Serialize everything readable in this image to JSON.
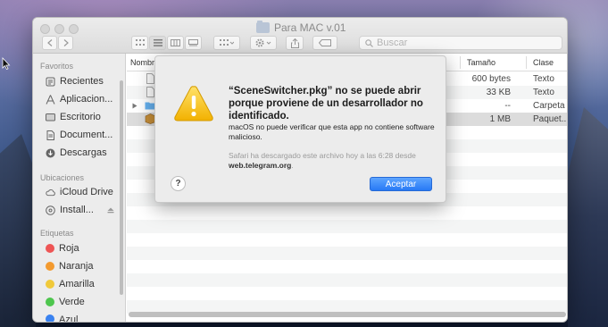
{
  "window": {
    "title": "Para MAC v.01",
    "search_placeholder": "Buscar"
  },
  "sidebar": {
    "favorites_heading": "Favoritos",
    "favorites": [
      {
        "label": "Recientes",
        "icon": "recents-icon"
      },
      {
        "label": "Aplicacion...",
        "icon": "applications-icon"
      },
      {
        "label": "Escritorio",
        "icon": "desktop-icon"
      },
      {
        "label": "Document...",
        "icon": "documents-icon"
      },
      {
        "label": "Descargas",
        "icon": "downloads-icon"
      }
    ],
    "locations_heading": "Ubicaciones",
    "locations": [
      {
        "label": "iCloud Drive",
        "icon": "cloud-icon"
      },
      {
        "label": "Install...",
        "icon": "disk-icon"
      }
    ],
    "tags_heading": "Etiquetas",
    "tags": [
      {
        "label": "Roja",
        "color": "#ee5555"
      },
      {
        "label": "Naranja",
        "color": "#f39a2f"
      },
      {
        "label": "Amarilla",
        "color": "#f0c93a"
      },
      {
        "label": "Verde",
        "color": "#4ec64e"
      },
      {
        "label": "Azul",
        "color": "#3a82f0"
      }
    ]
  },
  "list": {
    "columns": {
      "name": "Nombre",
      "size": "Tamaño",
      "kind": "Clase"
    },
    "rows": [
      {
        "size": "600 bytes",
        "kind": "Texto"
      },
      {
        "size": "33 KB",
        "kind": "Texto"
      },
      {
        "size": "--",
        "kind": "Carpeta"
      },
      {
        "size": "1 MB",
        "kind": "Paquet..."
      }
    ]
  },
  "dialog": {
    "title": "“SceneSwitcher.pkg” no se puede abrir porque proviene de un desarrollador no identificado.",
    "body": "macOS no puede verificar que esta app no contiene software malicioso.",
    "note_prefix": "Safari ha descargado este archivo hoy a las 6:28 desde",
    "note_source": "web.telegram.org",
    "note_suffix": ".",
    "help_label": "?",
    "ok_label": "Aceptar",
    "accent": "#2779f5"
  }
}
